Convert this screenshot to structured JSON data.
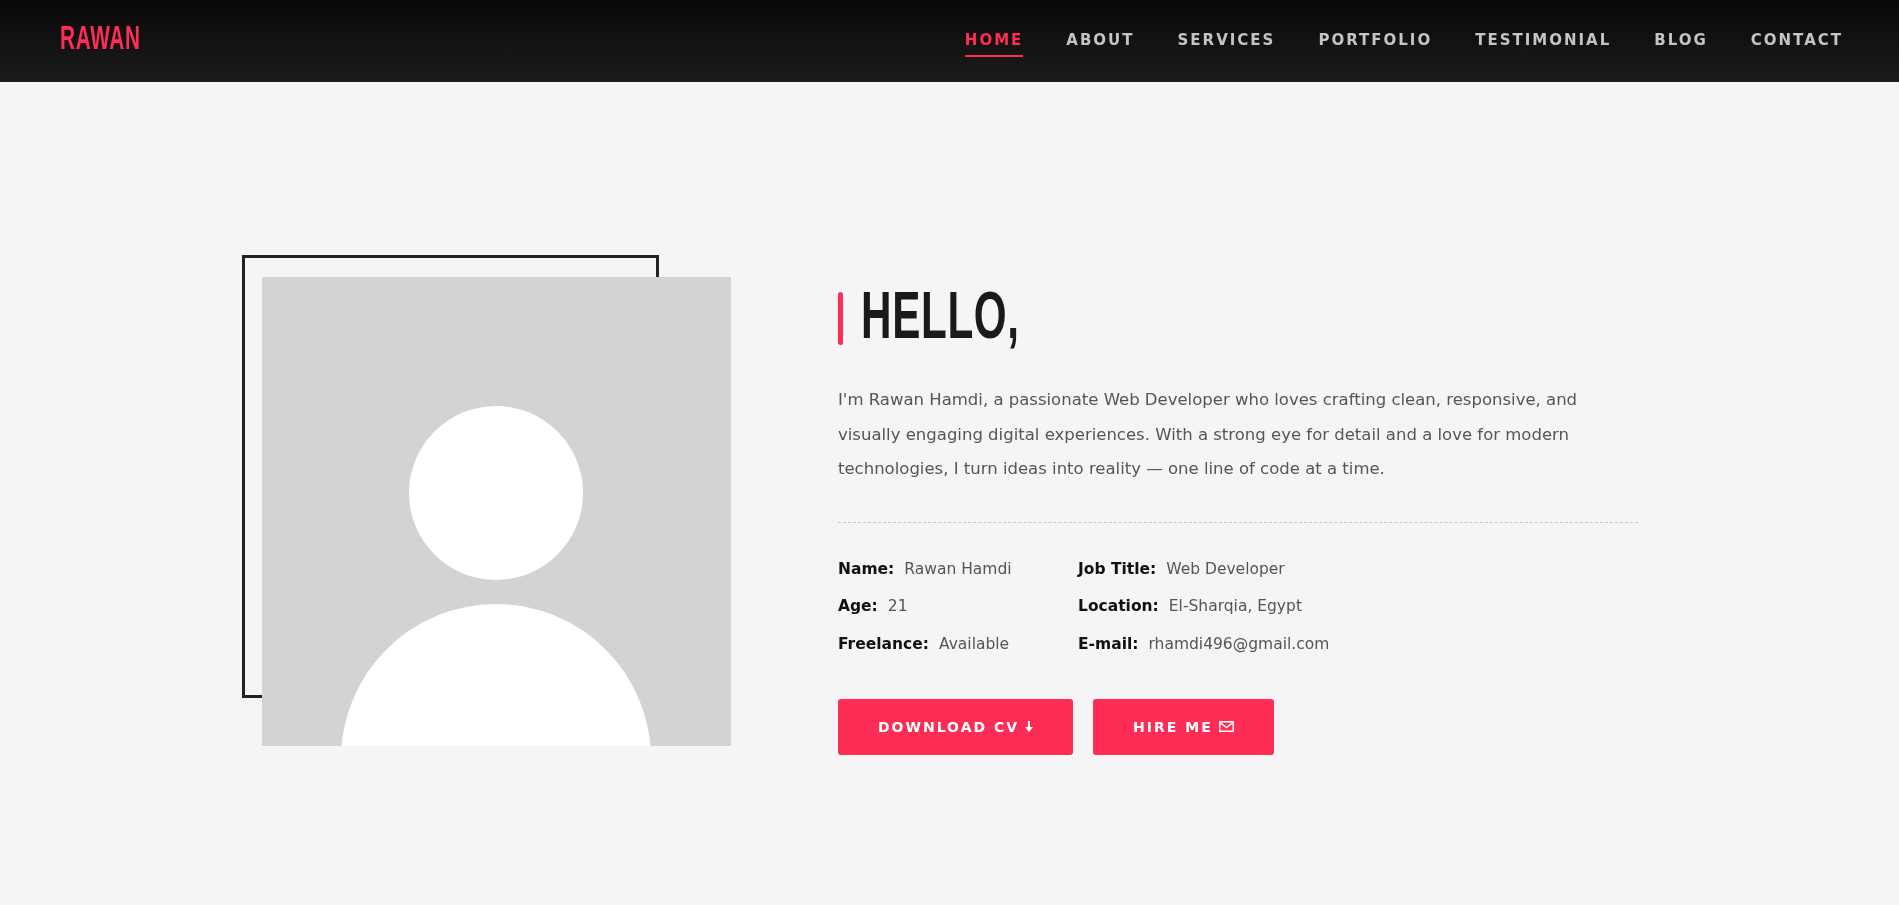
{
  "navbar": {
    "logo": "RAWAN",
    "links": [
      {
        "label": "HOME",
        "selected": true
      },
      {
        "label": "ABOUT",
        "selected": false
      },
      {
        "label": "SERVICES",
        "selected": false
      },
      {
        "label": "PORTFOLIO",
        "selected": false
      },
      {
        "label": "TESTIMONIAL",
        "selected": false
      },
      {
        "label": "BLOG",
        "selected": false
      },
      {
        "label": "CONTACT",
        "selected": false
      }
    ]
  },
  "about": {
    "heading": "HELLO,",
    "bio": "I'm Rawan Hamdi, a passionate Web Developer who loves crafting clean, responsive, and visually engaging digital experiences. With a strong eye for detail and a love for modern technologies, I turn ideas into reality — one line of code at a time.",
    "details": [
      {
        "label": "Name:",
        "value": "Rawan Hamdi"
      },
      {
        "label": "Job Title:",
        "value": "Web Developer"
      },
      {
        "label": "Age:",
        "value": "21"
      },
      {
        "label": "Location:",
        "value": "El-Sharqia, Egypt"
      },
      {
        "label": "Freelance:",
        "value": "Available"
      },
      {
        "label": "E-mail:",
        "value": "rhamdi496@gmail.com"
      }
    ],
    "buttons": [
      {
        "label": "DOWNLOAD CV",
        "kind": "download"
      },
      {
        "label": "HIRE ME",
        "kind": "mail"
      }
    ]
  }
}
